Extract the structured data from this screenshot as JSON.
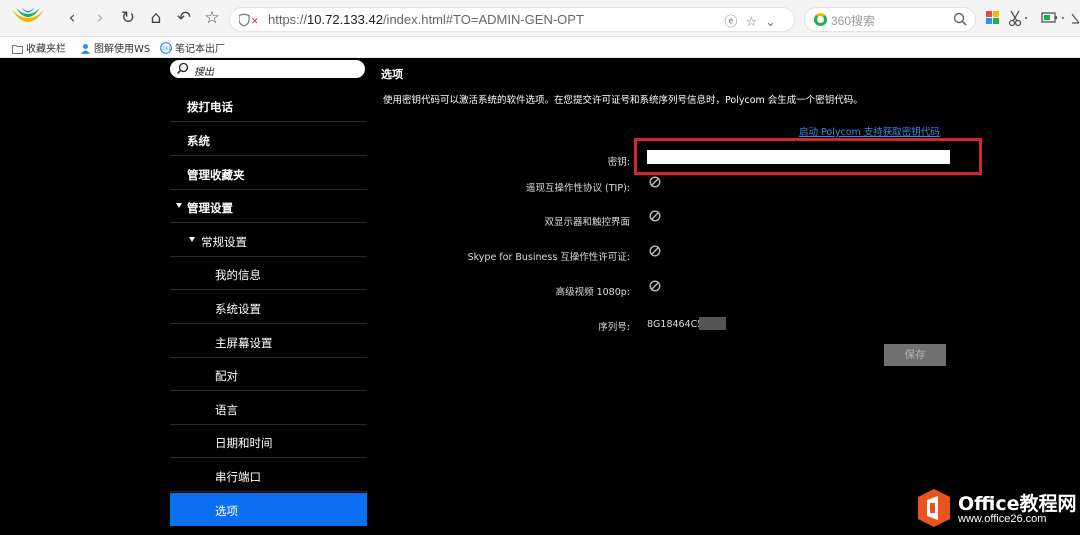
{
  "browser": {
    "url_prefix": "https://",
    "url_host": "10.72.133.42",
    "url_path": "/index.html#TO=ADMIN-GEN-OPT",
    "search_placeholder": "360搜索",
    "bookmarks": [
      {
        "label": "收藏夹栏",
        "icon": "folder-icon"
      },
      {
        "label": "图解使用WS",
        "icon": "user-icon"
      },
      {
        "label": "笔记本出厂",
        "icon": "dell-icon"
      }
    ]
  },
  "sidebar": {
    "search_label": "搜出",
    "items": [
      {
        "label": "拨打电话"
      },
      {
        "label": "系统"
      },
      {
        "label": "管理收藏夹"
      },
      {
        "label": "管理设置"
      },
      {
        "label": "常规设置"
      },
      {
        "label": "我的信息"
      },
      {
        "label": "系统设置"
      },
      {
        "label": "主屏幕设置"
      },
      {
        "label": "配对"
      },
      {
        "label": "语言"
      },
      {
        "label": "日期和时间"
      },
      {
        "label": "串行端口"
      },
      {
        "label": "选项"
      }
    ]
  },
  "main": {
    "title": "选项",
    "description": "使用密钥代码可以激活系统的软件选项。在您提交许可证号和系统序列号信息时，Polycom 会生成一个密钥代码。",
    "help_link": "启动 Polycom 支持获取密钥代码",
    "fields": {
      "key_label": "密钥:",
      "key_value": "",
      "tip_label": "遥现互操作性协议 (TIP):",
      "dual_label": "双显示器和触控界面",
      "skype_label": "Skype for Business 互操作性许可证:",
      "hd_label": "高级视频 1080p:",
      "serial_label": "序列号:",
      "serial_value": "8G18464C5"
    },
    "save_label": "保存"
  },
  "watermark": {
    "title": "Office教程网",
    "url": "www.office26.com"
  },
  "colors": {
    "accent": "#0c6ef0",
    "highlight": "#d0262c",
    "link": "#3d8be6"
  }
}
